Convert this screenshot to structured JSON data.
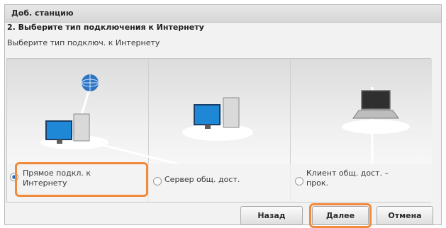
{
  "window": {
    "title": "Доб. станцию"
  },
  "step": {
    "title": "2. Выберите тип подключения к Интернету",
    "subtitle": "Выберите тип подключ. к Интернету"
  },
  "options": [
    {
      "label": "Прямое подкл. к Интернету",
      "selected": true
    },
    {
      "label": "Сервер общ. дост.",
      "selected": false
    },
    {
      "label": "Клиент общ. дост. – прок.",
      "selected": false
    }
  ],
  "buttons": {
    "back": "Назад",
    "next": "Далее",
    "cancel": "Отмена"
  },
  "colors": {
    "highlight": "#f08a3c",
    "accent": "#2c6db8"
  }
}
